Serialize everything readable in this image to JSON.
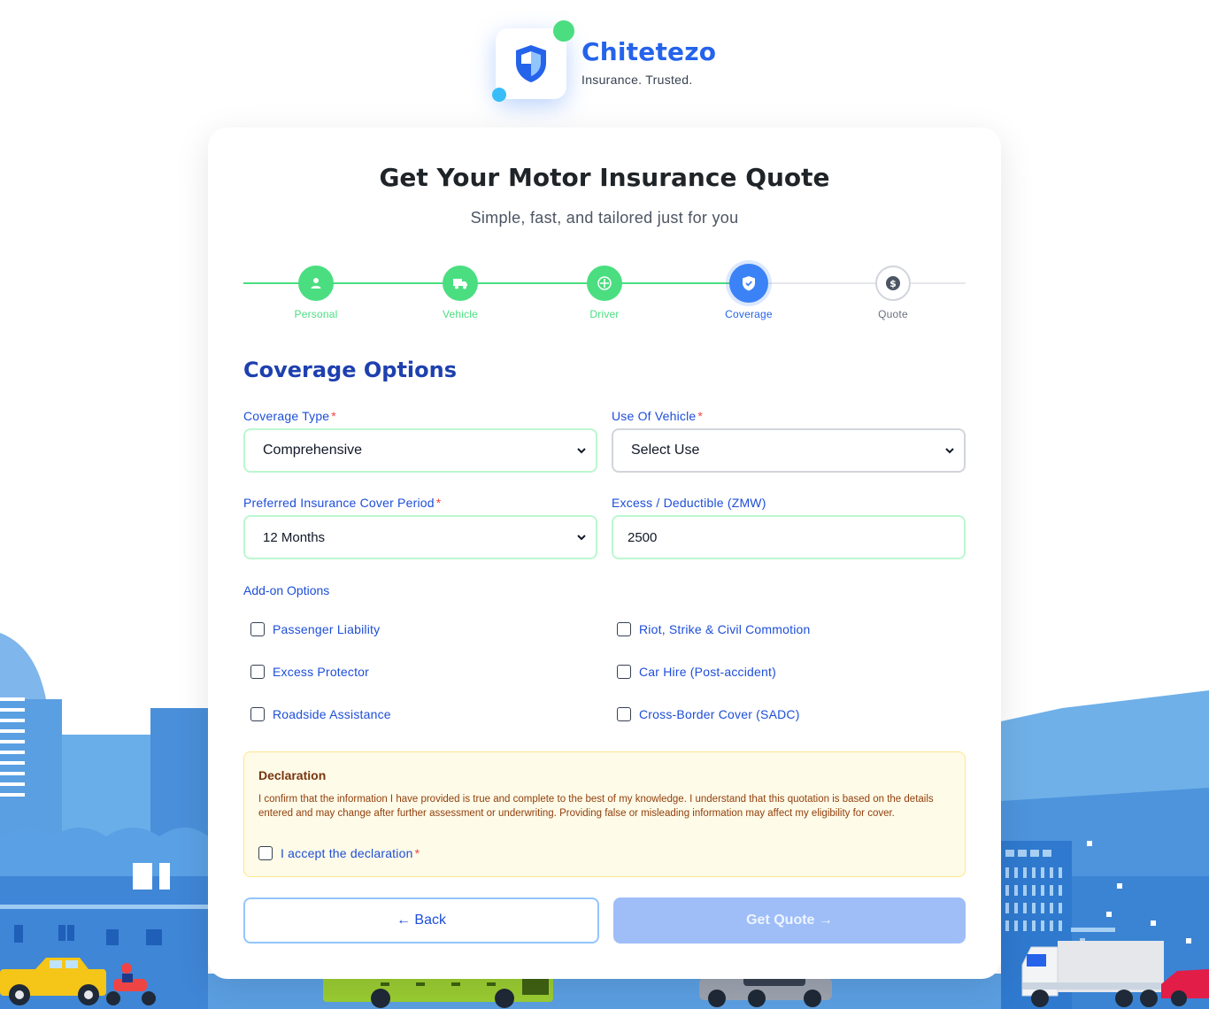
{
  "brand": {
    "name": "Chitetezo",
    "tagline": "Insurance. Trusted."
  },
  "header": {
    "title": "Get Your Motor Insurance Quote",
    "subtitle": "Simple, fast, and tailored just for you"
  },
  "steps": [
    {
      "label": "Personal",
      "status": "completed",
      "icon": "person-icon"
    },
    {
      "label": "Vehicle",
      "status": "completed",
      "icon": "truck-icon"
    },
    {
      "label": "Driver",
      "status": "completed",
      "icon": "steering-wheel-icon"
    },
    {
      "label": "Coverage",
      "status": "active",
      "icon": "shield-check-icon"
    },
    {
      "label": "Quote",
      "status": "pending",
      "icon": "dollar-icon"
    }
  ],
  "section": {
    "title": "Coverage Options"
  },
  "fields": {
    "coverage_type": {
      "label": "Coverage Type",
      "required": "*",
      "value": "Comprehensive"
    },
    "use_of_vehicle": {
      "label": "Use Of Vehicle",
      "required": "*",
      "value": "Select Use"
    },
    "cover_period": {
      "label": "Preferred Insurance Cover Period",
      "required": "*",
      "value": "12 Months"
    },
    "excess": {
      "label": "Excess / Deductible (ZMW)",
      "value": "2500"
    }
  },
  "addons": {
    "title": "Add-on Options",
    "items": [
      {
        "label": "Passenger Liability",
        "checked": false
      },
      {
        "label": "Riot, Strike & Civil Commotion",
        "checked": false
      },
      {
        "label": "Excess Protector",
        "checked": false
      },
      {
        "label": "Car Hire (Post-accident)",
        "checked": false
      },
      {
        "label": "Roadside Assistance",
        "checked": false
      },
      {
        "label": "Cross-Border Cover (SADC)",
        "checked": false
      }
    ]
  },
  "declaration": {
    "title": "Declaration",
    "text": "I confirm that the information I have provided is true and complete to the best of my knowledge. I understand that this quotation is based on the details entered and may change after further assessment or underwriting. Providing false or misleading information may affect my eligibility for cover.",
    "accept_label": "I accept the declaration",
    "required": "*",
    "checked": false
  },
  "buttons": {
    "back": "← Back",
    "get_quote": "Get Quote →"
  },
  "colors": {
    "primary": "#2563eb",
    "success": "#4ade80",
    "disabled_button": "#9fbef8",
    "declaration_bg": "#fefbe8"
  }
}
